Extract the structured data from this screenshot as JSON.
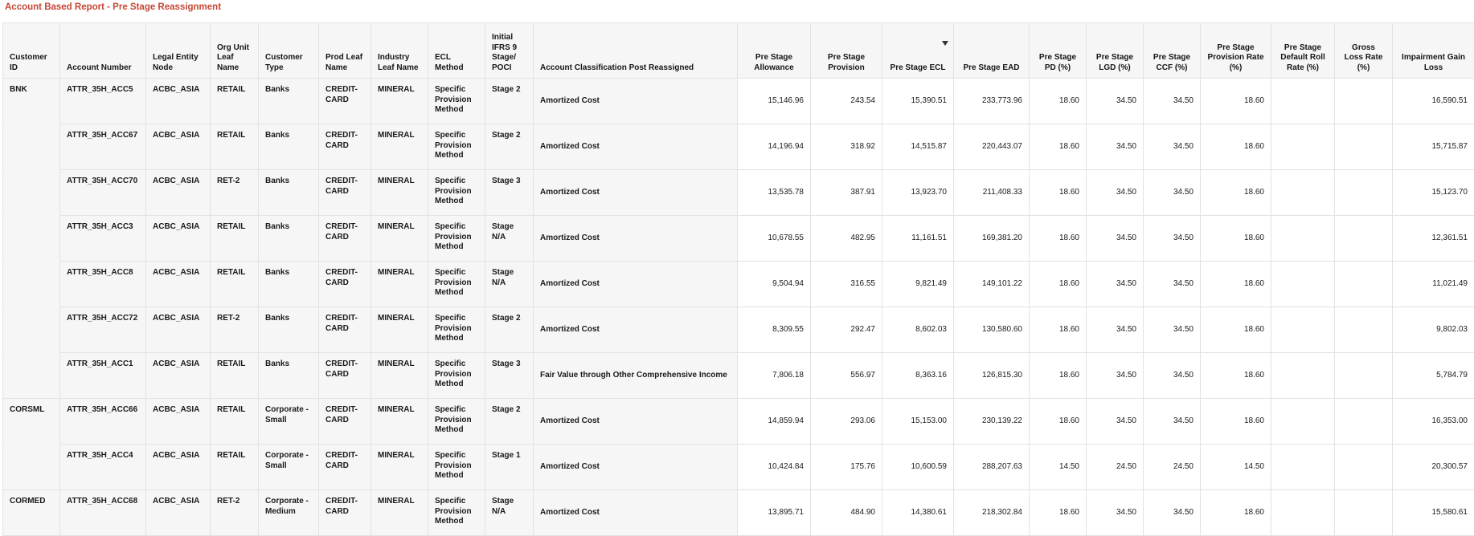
{
  "report": {
    "title": "Account Based Report - Pre Stage Reassignment"
  },
  "columns": [
    "Customer ID",
    "Account Number",
    "Legal Entity Node",
    "Org Unit Leaf Name",
    "Customer Type",
    "Prod Leaf Name",
    "Industry Leaf Name",
    "ECL Method",
    "Initial IFRS 9 Stage/ POCI",
    "Account Classification Post Reassigned",
    "Pre Stage Allowance",
    "Pre Stage Provision",
    "Pre Stage ECL",
    "Pre Stage EAD",
    "Pre Stage PD (%)",
    "Pre Stage LGD (%)",
    "Pre Stage CCF (%)",
    "Pre Stage Provision Rate (%)",
    "Pre Stage Default Roll Rate (%)",
    "Gross Loss Rate (%)",
    "Impairment Gain Loss"
  ],
  "sorted_column_icon": "sort-descending-icon",
  "rows": [
    [
      "BNK",
      "ATTR_35H_ACC5",
      "ACBC_ASIA",
      "RETAIL",
      "Banks",
      "CREDIT-CARD",
      "MINERAL",
      "Specific Provision Method",
      "Stage 2",
      "Amortized Cost",
      "15,146.96",
      "243.54",
      "15,390.51",
      "233,773.96",
      "18.60",
      "34.50",
      "34.50",
      "18.60",
      "",
      "",
      "16,590.51"
    ],
    [
      "",
      "ATTR_35H_ACC67",
      "ACBC_ASIA",
      "RETAIL",
      "Banks",
      "CREDIT-CARD",
      "MINERAL",
      "Specific Provision Method",
      "Stage 2",
      "Amortized Cost",
      "14,196.94",
      "318.92",
      "14,515.87",
      "220,443.07",
      "18.60",
      "34.50",
      "34.50",
      "18.60",
      "",
      "",
      "15,715.87"
    ],
    [
      "",
      "ATTR_35H_ACC70",
      "ACBC_ASIA",
      "RET-2",
      "Banks",
      "CREDIT-CARD",
      "MINERAL",
      "Specific Provision Method",
      "Stage 3",
      "Amortized Cost",
      "13,535.78",
      "387.91",
      "13,923.70",
      "211,408.33",
      "18.60",
      "34.50",
      "34.50",
      "18.60",
      "",
      "",
      "15,123.70"
    ],
    [
      "",
      "ATTR_35H_ACC3",
      "ACBC_ASIA",
      "RETAIL",
      "Banks",
      "CREDIT-CARD",
      "MINERAL",
      "Specific Provision Method",
      "Stage N/A",
      "Amortized Cost",
      "10,678.55",
      "482.95",
      "11,161.51",
      "169,381.20",
      "18.60",
      "34.50",
      "34.50",
      "18.60",
      "",
      "",
      "12,361.51"
    ],
    [
      "",
      "ATTR_35H_ACC8",
      "ACBC_ASIA",
      "RETAIL",
      "Banks",
      "CREDIT-CARD",
      "MINERAL",
      "Specific Provision Method",
      "Stage N/A",
      "Amortized Cost",
      "9,504.94",
      "316.55",
      "9,821.49",
      "149,101.22",
      "18.60",
      "34.50",
      "34.50",
      "18.60",
      "",
      "",
      "11,021.49"
    ],
    [
      "",
      "ATTR_35H_ACC72",
      "ACBC_ASIA",
      "RET-2",
      "Banks",
      "CREDIT-CARD",
      "MINERAL",
      "Specific Provision Method",
      "Stage 2",
      "Amortized Cost",
      "8,309.55",
      "292.47",
      "8,602.03",
      "130,580.60",
      "18.60",
      "34.50",
      "34.50",
      "18.60",
      "",
      "",
      "9,802.03"
    ],
    [
      "",
      "ATTR_35H_ACC1",
      "ACBC_ASIA",
      "RETAIL",
      "Banks",
      "CREDIT-CARD",
      "MINERAL",
      "Specific Provision Method",
      "Stage 3",
      "Fair Value through Other Comprehensive Income",
      "7,806.18",
      "556.97",
      "8,363.16",
      "126,815.30",
      "18.60",
      "34.50",
      "34.50",
      "18.60",
      "",
      "",
      "5,784.79"
    ],
    [
      "CORSML",
      "ATTR_35H_ACC66",
      "ACBC_ASIA",
      "RETAIL",
      "Corporate - Small",
      "CREDIT-CARD",
      "MINERAL",
      "Specific Provision Method",
      "Stage 2",
      "Amortized Cost",
      "14,859.94",
      "293.06",
      "15,153.00",
      "230,139.22",
      "18.60",
      "34.50",
      "34.50",
      "18.60",
      "",
      "",
      "16,353.00"
    ],
    [
      "",
      "ATTR_35H_ACC4",
      "ACBC_ASIA",
      "RETAIL",
      "Corporate - Small",
      "CREDIT-CARD",
      "MINERAL",
      "Specific Provision Method",
      "Stage 1",
      "Amortized Cost",
      "10,424.84",
      "175.76",
      "10,600.59",
      "288,207.63",
      "14.50",
      "24.50",
      "24.50",
      "14.50",
      "",
      "",
      "20,300.57"
    ],
    [
      "CORMED",
      "ATTR_35H_ACC68",
      "ACBC_ASIA",
      "RET-2",
      "Corporate - Medium",
      "CREDIT-CARD",
      "MINERAL",
      "Specific Provision Method",
      "Stage N/A",
      "Amortized Cost",
      "13,895.71",
      "484.90",
      "14,380.61",
      "218,302.84",
      "18.60",
      "34.50",
      "34.50",
      "18.60",
      "",
      "",
      "15,580.61"
    ]
  ]
}
